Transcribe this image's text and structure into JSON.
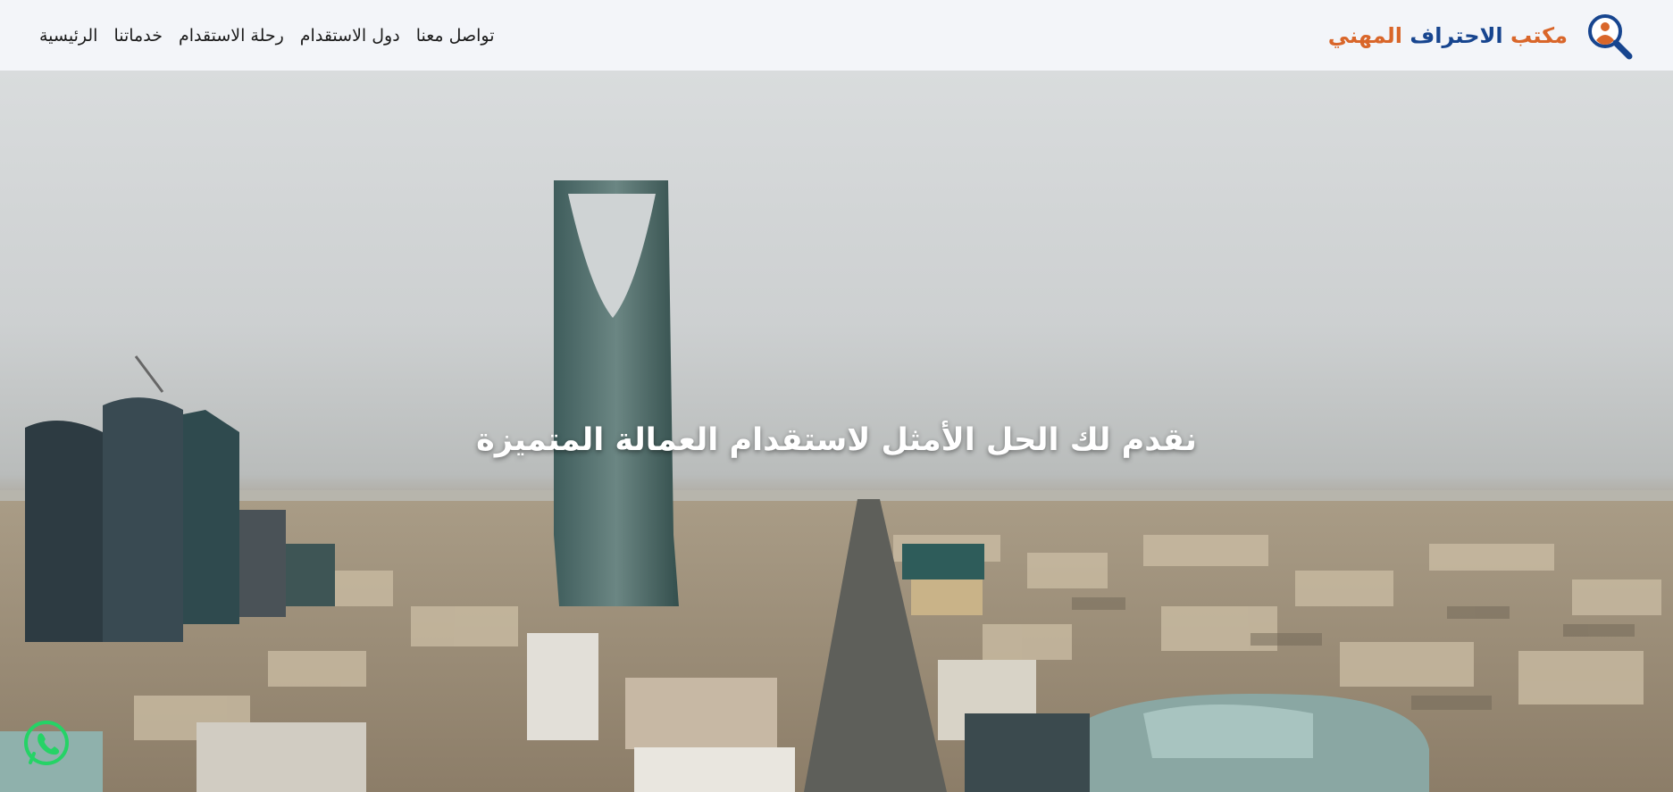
{
  "header": {
    "brand": {
      "word1": "مكتب",
      "word2": "الاحتراف",
      "word3": "المهني",
      "logo_icon": "search-person-icon"
    },
    "nav": [
      {
        "label": "الرئيسية"
      },
      {
        "label": "خدماتنا"
      },
      {
        "label": "رحلة الاستقدام"
      },
      {
        "label": "دول الاستقدام"
      },
      {
        "label": "تواصل معنا"
      }
    ]
  },
  "hero": {
    "title": "نقدم لك الحل الأمثل لاستقدام العمالة المتميزة",
    "background": "riyadh-skyline-photo"
  },
  "floating": {
    "whatsapp_icon": "whatsapp-icon"
  },
  "colors": {
    "brand_orange": "#d9662a",
    "brand_blue": "#17458f",
    "whatsapp_green": "#25d366"
  }
}
